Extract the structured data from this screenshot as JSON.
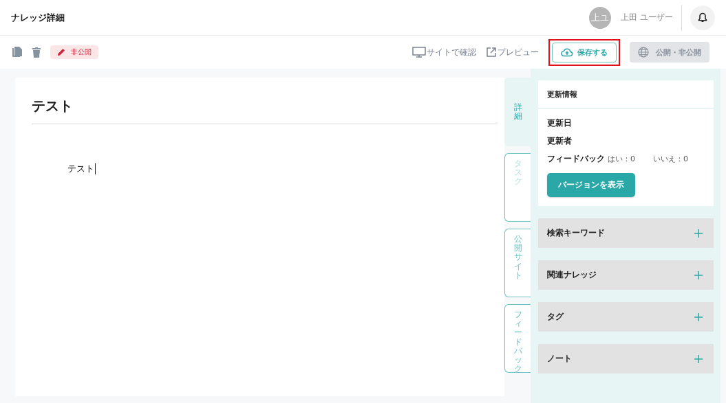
{
  "header": {
    "title": "ナレッジ詳細",
    "avatar": "上ユ",
    "user_name": "上田 ユーザー"
  },
  "toolbar": {
    "status_badge": "非公開",
    "site_check": "サイトで確認",
    "preview": "プレビュー",
    "save": {
      "label": "保存する",
      "highlighted": true
    },
    "publish": {
      "label": "公開・非公開",
      "disabled": true
    }
  },
  "editor": {
    "title": "テスト",
    "body": "テスト"
  },
  "side_tabs": [
    {
      "label": "詳細",
      "selected": true,
      "disabled": false
    },
    {
      "label": "タスク",
      "selected": false,
      "disabled": true
    },
    {
      "label": "公開サイト",
      "selected": false,
      "disabled": false
    },
    {
      "label": "フィードバック",
      "selected": false,
      "disabled": false
    }
  ],
  "update_info": {
    "heading": "更新情報",
    "updated_on": "更新日",
    "updated_by": "更新者",
    "feedback_label": "フィードバック",
    "feedback_yes": "はい：0",
    "feedback_no": "いいえ：0",
    "version_button": "バージョンを表示"
  },
  "sections": [
    {
      "title": "検索キーワード",
      "expanded": false
    },
    {
      "title": "関連ナレッジ",
      "expanded": false
    },
    {
      "title": "タグ",
      "expanded": false
    },
    {
      "title": "ノート",
      "expanded": false
    }
  ]
}
